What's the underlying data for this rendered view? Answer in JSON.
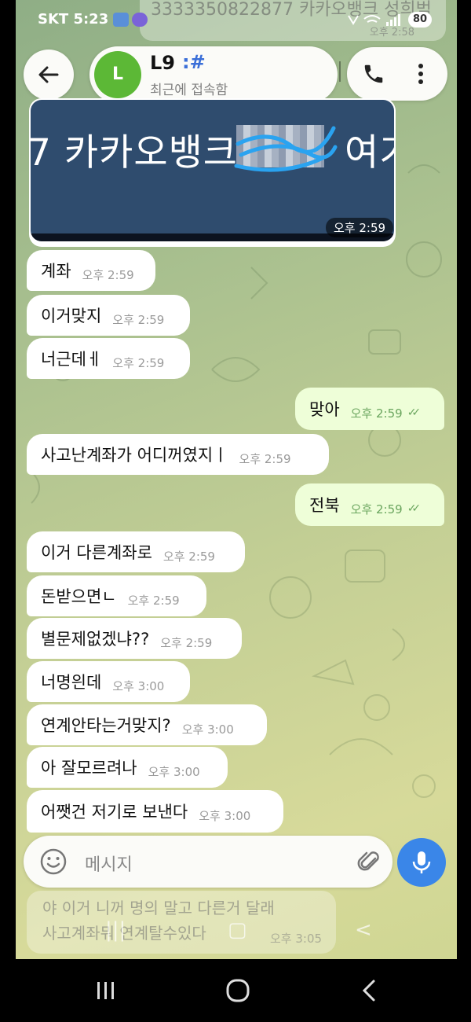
{
  "status_bar": {
    "carrier_time": "SKT 5:23",
    "battery": "80"
  },
  "ghost_top": {
    "text": "3333350822877 카카오뱅크 성희범",
    "time": "오후 2:58"
  },
  "header": {
    "avatar_letter": "L",
    "chat_name": "L9",
    "chat_tag": ":#",
    "status": "최근에 접속함"
  },
  "image_message": {
    "text": "7 카카오뱅크",
    "text_after": "여기",
    "time": "오후 2:59"
  },
  "messages": [
    {
      "text": "계좌",
      "time": "오후 2:59"
    },
    {
      "text": "이거맞지",
      "time": "오후 2:59"
    },
    {
      "text": "너근데ㅔ",
      "time": "오후 2:59"
    },
    {
      "text": "맞아",
      "time": "오후 2:59"
    },
    {
      "text": "사고난계좌가 어디꺼였지ㅣ",
      "time": "오후 2:59"
    },
    {
      "text": "전북",
      "time": "오후 2:59"
    },
    {
      "text": "이거 다른계좌로",
      "time": "오후 2:59"
    },
    {
      "text": "돈받으면ㄴ",
      "time": "오후 2:59"
    },
    {
      "text": "별문제없겠냐??",
      "time": "오후 2:59"
    },
    {
      "text": "너명읜데",
      "time": "오후 3:00"
    },
    {
      "text": "연계안타는거맞지?",
      "time": "오후 3:00"
    },
    {
      "text": "아 잘모르려나",
      "time": "오후 3:00"
    },
    {
      "text": "어쨋건 저기로 보낸다",
      "time": "오후 3:00"
    }
  ],
  "input": {
    "placeholder": "메시지"
  },
  "ghost_bottom": {
    "line1": "야 이거 니꺼 명의 말고 다른거 달래",
    "line2": "사고계좌뭐 연계탈수있다",
    "time": "오후 3:05"
  },
  "colors": {
    "incoming": "#ffffff",
    "outgoing": "#eefed8",
    "accent": "#3a86e8",
    "avatar": "#5cb836"
  }
}
